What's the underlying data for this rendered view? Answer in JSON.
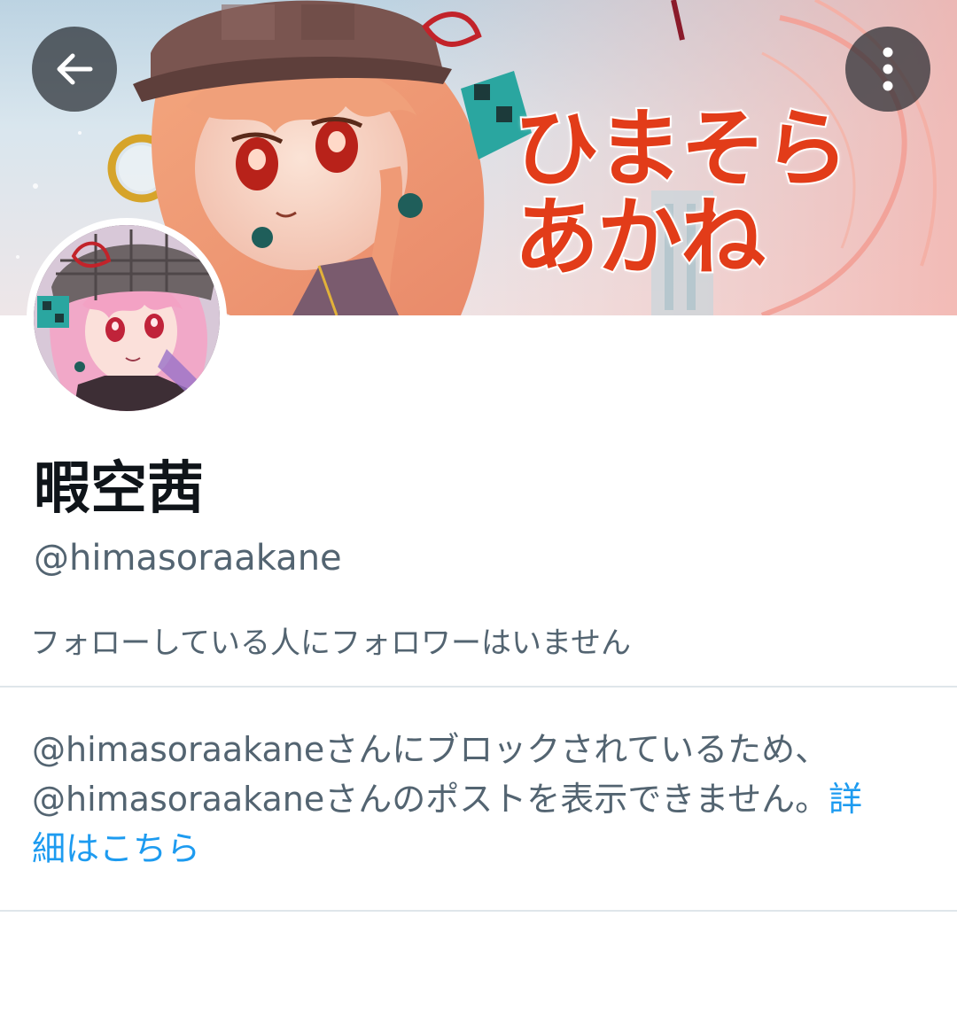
{
  "banner": {
    "title_line1": "ひまそら",
    "title_line2": "あかね"
  },
  "nav": {
    "back_icon": "arrow-left-icon",
    "more_icon": "more-vertical-icon"
  },
  "profile": {
    "display_name": "暇空茜",
    "handle": "@himasoraakane",
    "follow_note": "フォローしている人にフォロワーはいません"
  },
  "blocked": {
    "line1": "@himasoraakaneさんにブロックされているため、",
    "line2": "@himasoraakaneさんのポストを表示できません。",
    "link_part1": "詳",
    "link_part2": "細はこちら"
  },
  "colors": {
    "text_primary": "#0f1419",
    "text_secondary": "#536471",
    "link": "#1d9bf0",
    "banner_title": "#e23c19",
    "divider": "#dfe6ea"
  }
}
